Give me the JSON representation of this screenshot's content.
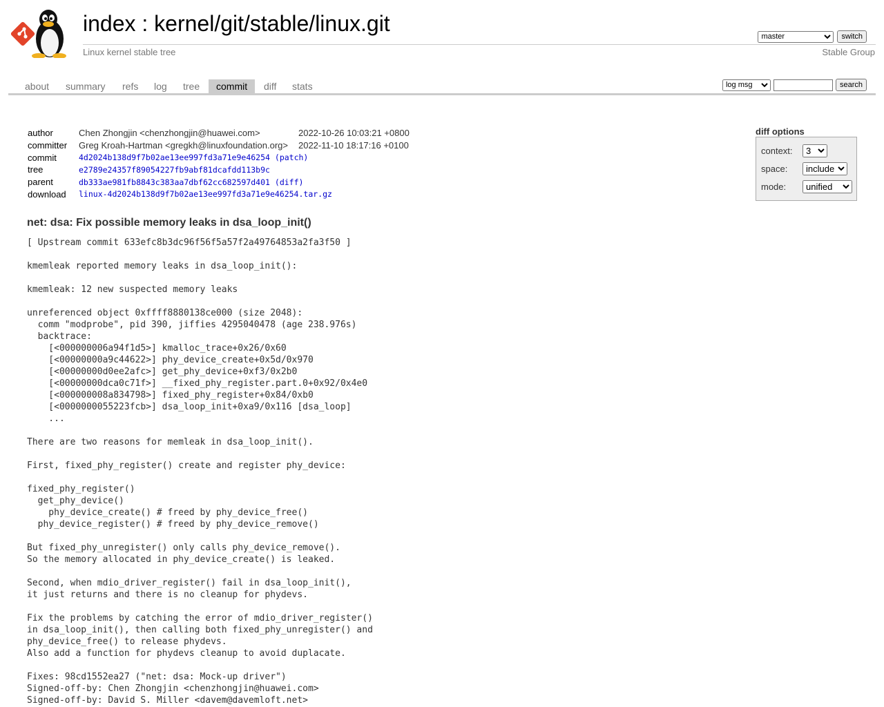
{
  "header": {
    "title_prefix": "index",
    "title_sep": " : ",
    "repo_path": "kernel/git/stable/linux.git",
    "description": "Linux kernel stable tree",
    "owner": "Stable Group",
    "branch_selected": "master",
    "switch_label": "switch"
  },
  "tabs": [
    {
      "label": "about"
    },
    {
      "label": "summary"
    },
    {
      "label": "refs"
    },
    {
      "label": "log"
    },
    {
      "label": "tree"
    },
    {
      "label": "commit",
      "active": true
    },
    {
      "label": "diff"
    },
    {
      "label": "stats"
    }
  ],
  "search": {
    "kind_selected": "log msg",
    "value": "",
    "button_label": "search"
  },
  "commit_info": {
    "author_label": "author",
    "author": "Chen Zhongjin <chenzhongjin@huawei.com>",
    "author_date": "2022-10-26 10:03:21 +0800",
    "committer_label": "committer",
    "committer": "Greg Kroah-Hartman <gregkh@linuxfoundation.org>",
    "committer_date": "2022-11-10 18:17:16 +0100",
    "commit_label": "commit",
    "commit_hash": "4d2024b138d9f7b02ae13ee997fd3a71e9e46254",
    "patch_link": "(patch)",
    "tree_label": "tree",
    "tree_hash": "e2789e24357f89054227fb9abf81dcafdd113b9c",
    "parent_label": "parent",
    "parent_hash": "db333ae981fb8843c383aa7dbf62cc682597d401",
    "diff_link": "(diff)",
    "download_label": "download",
    "download_file": "linux-4d2024b138d9f7b02ae13ee997fd3a71e9e46254.tar.gz"
  },
  "diff_options": {
    "title": "diff options",
    "context_label": "context:",
    "context_value": "3",
    "space_label": "space:",
    "space_value": "include",
    "mode_label": "mode:",
    "mode_value": "unified"
  },
  "commit_message": {
    "subject": "net: dsa: Fix possible memory leaks in dsa_loop_init()",
    "body": "[ Upstream commit 633efc8b3dc96f56f5a57f2a49764853a2fa3f50 ]\n\nkmemleak reported memory leaks in dsa_loop_init():\n\nkmemleak: 12 new suspected memory leaks\n\nunreferenced object 0xffff8880138ce000 (size 2048):\n  comm \"modprobe\", pid 390, jiffies 4295040478 (age 238.976s)\n  backtrace:\n    [<000000006a94f1d5>] kmalloc_trace+0x26/0x60\n    [<00000000a9c44622>] phy_device_create+0x5d/0x970\n    [<00000000d0ee2afc>] get_phy_device+0xf3/0x2b0\n    [<00000000dca0c71f>] __fixed_phy_register.part.0+0x92/0x4e0\n    [<000000008a834798>] fixed_phy_register+0x84/0xb0\n    [<0000000055223fcb>] dsa_loop_init+0xa9/0x116 [dsa_loop]\n    ...\n\nThere are two reasons for memleak in dsa_loop_init().\n\nFirst, fixed_phy_register() create and register phy_device:\n\nfixed_phy_register()\n  get_phy_device()\n    phy_device_create() # freed by phy_device_free()\n  phy_device_register() # freed by phy_device_remove()\n\nBut fixed_phy_unregister() only calls phy_device_remove().\nSo the memory allocated in phy_device_create() is leaked.\n\nSecond, when mdio_driver_register() fail in dsa_loop_init(),\nit just returns and there is no cleanup for phydevs.\n\nFix the problems by catching the error of mdio_driver_register()\nin dsa_loop_init(), then calling both fixed_phy_unregister() and\nphy_device_free() to release phydevs.\nAlso add a function for phydevs cleanup to avoid duplacate.\n\nFixes: 98cd1552ea27 (\"net: dsa: Mock-up driver\")\nSigned-off-by: Chen Zhongjin <chenzhongjin@huawei.com>\nSigned-off-by: David S. Miller <davem@davemloft.net>"
  },
  "colors": {
    "link": "#0000cc",
    "tab_active_bg": "#cccccc",
    "muted_text": "#777777",
    "git_logo": "#e24329"
  }
}
